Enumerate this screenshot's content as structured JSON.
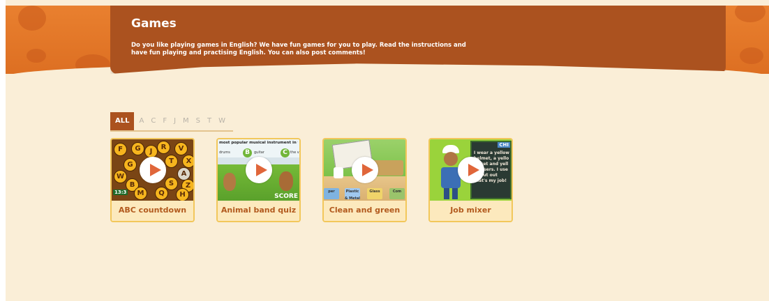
{
  "header": {
    "title": "Games",
    "description": "Do you like playing games in English? We have fun games for you to play. Read the instructions and have fun playing and practising English. You can also post comments!"
  },
  "filter": {
    "items": [
      "ALL",
      "A",
      "C",
      "F",
      "J",
      "M",
      "S",
      "T",
      "W"
    ],
    "active": "ALL"
  },
  "games": [
    {
      "title": "ABC countdown",
      "thumbnail": "abc-countdown",
      "counter": "13:3"
    },
    {
      "title": "Animal band quiz",
      "thumbnail": "animal-band-quiz",
      "question": "most popular musical instrument in the w",
      "options": [
        "drums",
        "B",
        "guitar",
        "C",
        "the v"
      ],
      "score_label": "SCORE"
    },
    {
      "title": "Clean and green",
      "thumbnail": "clean-and-green",
      "bins": [
        "per",
        "Plastic & Metal",
        "Glass",
        "Com"
      ]
    },
    {
      "title": "Job mixer",
      "thumbnail": "job-mixer",
      "tag": "CHI",
      "board_text": "I wear a yellow\nhelmet, a yello\njacket and yell\ntrousers. I use\nto put out\nthat's my job!"
    }
  ],
  "colors": {
    "header_bg": "#ab521f",
    "page_bg": "#faeed7",
    "card_border": "#f2c75b",
    "card_title": "#b25a1e",
    "play_icon": "#e0663a"
  }
}
